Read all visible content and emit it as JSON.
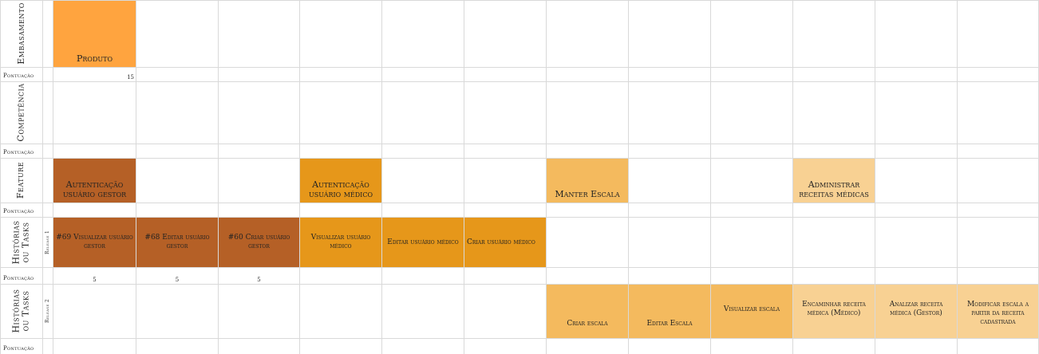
{
  "rows": {
    "embasamento": "Embasamento",
    "competencia": "Competência",
    "feature": "Feature",
    "historias": "Histórias ou Tasks",
    "release1": "Release 1",
    "release2": "Release 2",
    "pontuacao": "Pontuação"
  },
  "embasamento": {
    "card": "Produto",
    "score": "15"
  },
  "features": [
    "Autenticação usuário gestor",
    "Autenticação usuário médico",
    "Manter Escala",
    "Administrar receitas médicas"
  ],
  "release1": {
    "cards": [
      "#69 Visualizar usuário gestor",
      "#68 Editar usuário gestor",
      "#60 Criar usuário gestor",
      "Visualizar usuário médico",
      "Editar usuário médico",
      "Criar usuário médico"
    ],
    "scores": [
      "5",
      "5",
      "5"
    ]
  },
  "release2": {
    "cards": [
      "Criar escala",
      "Editar Escala",
      "Visualizar escala",
      "Encaminhar receita médica (Médico)",
      "Analizar receita médica (Gestor)",
      "Modificar escala a partir da receita cadastrada"
    ]
  },
  "colors": {
    "embasamento": "#ffa43f",
    "gestor": "#b56026",
    "medico": "#e6971a",
    "escala": "#f4ba5e",
    "receitas": "#f8d193",
    "grid": "#d9d9d9"
  }
}
